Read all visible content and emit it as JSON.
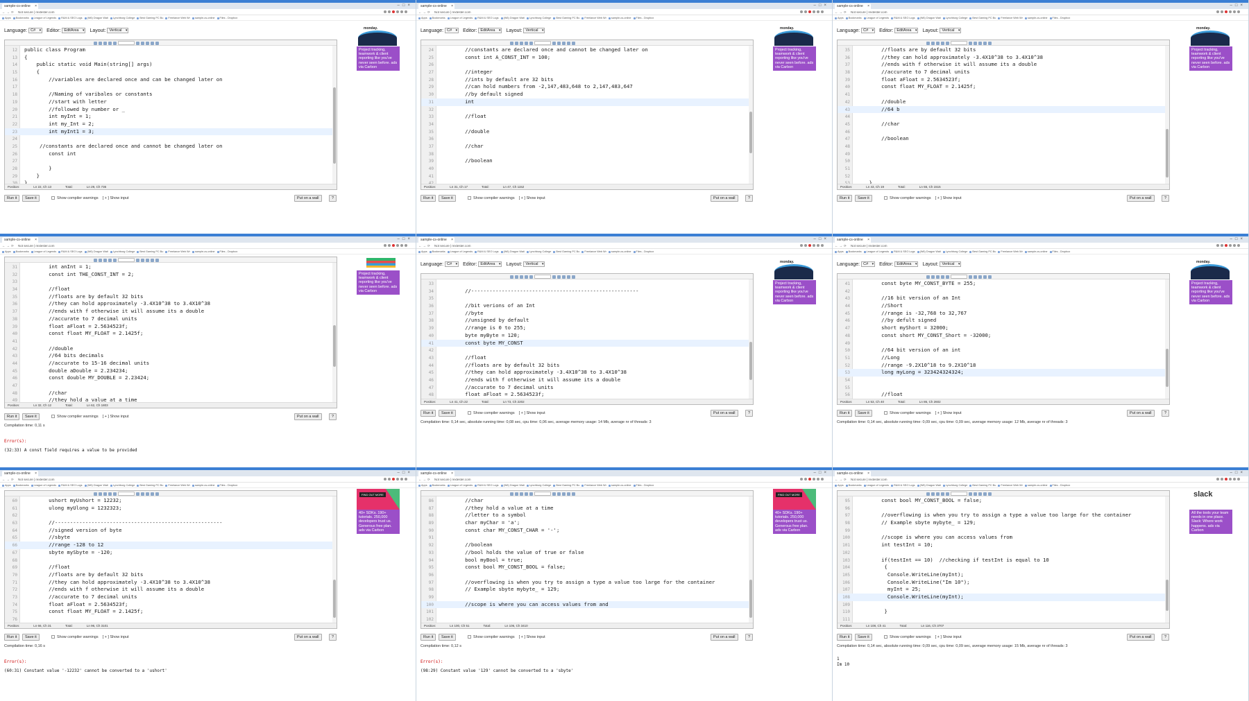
{
  "browser": {
    "tab_title": "sample-cs-online",
    "url": "Not secure | rextester.com",
    "bookmarks": [
      "Apps",
      "Bookmarks",
      "League of Legends",
      "R&M & SEO Logs",
      "(W6) Dragon Wati",
      "Lynchburg College",
      "Best Gaming PC Bu",
      "Freelance Web Wr",
      "sample-cs-online",
      "Files - Dropbox"
    ]
  },
  "options": {
    "language_label": "Language:",
    "language_value": "C#",
    "editor_label": "Editor:",
    "editor_value": "EditArea",
    "layout_label": "Layout:",
    "layout_value": "Vertical"
  },
  "buttons": {
    "run": "Run it",
    "save": "Save it",
    "warnings": "Show compiler warnings",
    "input": "[ + ] Show input",
    "wall": "Put on a wall",
    "help": "?"
  },
  "ads": {
    "monday_logo": "monday.",
    "monday_text": "Project tracking, teamwork & client reporting like you've never seen before. ads via Carbon",
    "pink_cta": "FIND OUT MORE",
    "pink_text": "40+ SDKs. 190+ tutorials. 250,000 developers trust us. Generous free plan. ads via Carbon",
    "slack_logo": "slack",
    "slack_text": "All the tools your team needs in one place. Slack: Where work happens. ads via Carbon"
  },
  "panels": [
    {
      "lines": [
        {
          "n": "12",
          "t": "public class Program"
        },
        {
          "n": "13",
          "t": "{"
        },
        {
          "n": "14",
          "t": "    public static void Main(string[] args)"
        },
        {
          "n": "15",
          "t": "    {"
        },
        {
          "n": "16",
          "t": "        //variables are declared once and can be changed later on"
        },
        {
          "n": "17",
          "t": ""
        },
        {
          "n": "18",
          "t": "        //Naming of varibales or constants"
        },
        {
          "n": "19",
          "t": "        //start with letter"
        },
        {
          "n": "20",
          "t": "        //followed by number or _"
        },
        {
          "n": "21",
          "t": "        int myInt = 1;"
        },
        {
          "n": "22",
          "t": "        int my_Int = 2;"
        },
        {
          "n": "23",
          "t": "        int myInt1 = 3;"
        },
        {
          "n": "24",
          "t": ""
        },
        {
          "n": "25",
          "t": "     //constants are declared once and cannot be changed later on"
        },
        {
          "n": "26",
          "t": "        const int"
        },
        {
          "n": "27",
          "t": ""
        },
        {
          "n": "28",
          "t": "        }"
        },
        {
          "n": "29",
          "t": "    }"
        },
        {
          "n": "30",
          "t": "}"
        }
      ],
      "position": "Ln 22, Ch 13",
      "total": "Ln 29, Ch 736",
      "compilation": "",
      "errors_label": "",
      "error_text": "",
      "output": ""
    },
    {
      "lines": [
        {
          "n": "24",
          "t": "        //constants are declared once and cannot be changed later on"
        },
        {
          "n": "25",
          "t": "        const int A_CONST_INT = 100;"
        },
        {
          "n": "26",
          "t": ""
        },
        {
          "n": "27",
          "t": "        //integer"
        },
        {
          "n": "28",
          "t": "        //ints by default are 32 bits"
        },
        {
          "n": "29",
          "t": "        //can hold numbers from -2,147,483,648 to 2,147,483,647"
        },
        {
          "n": "30",
          "t": "        //by default signed"
        },
        {
          "n": "31",
          "t": "        int"
        },
        {
          "n": "32",
          "t": ""
        },
        {
          "n": "33",
          "t": "        //float"
        },
        {
          "n": "34",
          "t": ""
        },
        {
          "n": "35",
          "t": "        //double"
        },
        {
          "n": "36",
          "t": ""
        },
        {
          "n": "37",
          "t": "        //char"
        },
        {
          "n": "38",
          "t": ""
        },
        {
          "n": "39",
          "t": "        //boolean"
        },
        {
          "n": "40",
          "t": ""
        },
        {
          "n": "41",
          "t": ""
        },
        {
          "n": "42",
          "t": ""
        }
      ],
      "position": "Ln 31, Ch 17",
      "total": "Ln 47, Ch 1152",
      "compilation": "",
      "errors_label": "",
      "error_text": "",
      "output": ""
    },
    {
      "lines": [
        {
          "n": "35",
          "t": "        //floats are by default 32 bits"
        },
        {
          "n": "36",
          "t": "        //they can hold approximately -3.4X10^38 to 3.4X10^38"
        },
        {
          "n": "37",
          "t": "        //ends with f otherwise it will assume its a double"
        },
        {
          "n": "38",
          "t": "        //accurate to 7 decimal units"
        },
        {
          "n": "39",
          "t": "        float aFloat = 2.5634523f;"
        },
        {
          "n": "40",
          "t": "        const float MY_FLOAT = 2.1425f;"
        },
        {
          "n": "41",
          "t": ""
        },
        {
          "n": "42",
          "t": "        //double"
        },
        {
          "n": "43",
          "t": "        //64 b"
        },
        {
          "n": "44",
          "t": ""
        },
        {
          "n": "45",
          "t": "        //char"
        },
        {
          "n": "46",
          "t": ""
        },
        {
          "n": "47",
          "t": "        //boolean"
        },
        {
          "n": "48",
          "t": ""
        },
        {
          "n": "49",
          "t": ""
        },
        {
          "n": "50",
          "t": ""
        },
        {
          "n": "51",
          "t": ""
        },
        {
          "n": "52",
          "t": ""
        },
        {
          "n": "53",
          "t": "    }"
        }
      ],
      "position": "Ln 43, Ch 19",
      "total": "Ln 55, Ch 1515",
      "compilation": "",
      "errors_label": "",
      "error_text": "",
      "output": ""
    },
    {
      "lines": [
        {
          "n": "31",
          "t": "        int anInt = 1;"
        },
        {
          "n": "32",
          "t": "        const int THE_CONST_INT = 2;"
        },
        {
          "n": "33",
          "t": ""
        },
        {
          "n": "34",
          "t": "        //float"
        },
        {
          "n": "35",
          "t": "        //floats are by default 32 bits"
        },
        {
          "n": "36",
          "t": "        //they can hold approximately -3.4X10^38 to 3.4X10^38"
        },
        {
          "n": "37",
          "t": "        //ends with f otherwise it will assume its a double"
        },
        {
          "n": "38",
          "t": "        //accurate to 7 decimal units"
        },
        {
          "n": "39",
          "t": "        float aFloat = 2.5634523f;"
        },
        {
          "n": "40",
          "t": "        const float MY_FLOAT = 2.1425f;"
        },
        {
          "n": "41",
          "t": ""
        },
        {
          "n": "42",
          "t": "        //double"
        },
        {
          "n": "43",
          "t": "        //64 bits decimals"
        },
        {
          "n": "44",
          "t": "        //accurate to 15-16 decimal units"
        },
        {
          "n": "45",
          "t": "        double aDouble = 2.234234;"
        },
        {
          "n": "46",
          "t": "        const double MY_DOUBLE = 2.23424;"
        },
        {
          "n": "47",
          "t": ""
        },
        {
          "n": "48",
          "t": "        //char"
        },
        {
          "n": "49",
          "t": "        //they hold a value at a time"
        }
      ],
      "position": "Ln 32, Ch 12",
      "total": "Ln 62, Ch 1803",
      "compilation": "Compilation time: 0,11 s",
      "errors_label": "Error(s):",
      "error_text": "(32:33) A const field requires a value to be provided",
      "output": ""
    },
    {
      "lines": [
        {
          "n": "33",
          "t": ""
        },
        {
          "n": "34",
          "t": "        //-------------------------------------------------------"
        },
        {
          "n": "35",
          "t": ""
        },
        {
          "n": "36",
          "t": "        //bit verions of an Int"
        },
        {
          "n": "37",
          "t": "        //byte"
        },
        {
          "n": "38",
          "t": "        //unsigned by default"
        },
        {
          "n": "39",
          "t": "        //range is 0 to 255;"
        },
        {
          "n": "40",
          "t": "        byte myByte = 120;"
        },
        {
          "n": "41",
          "t": "        const byte MY_CONST"
        },
        {
          "n": "42",
          "t": ""
        },
        {
          "n": "43",
          "t": "        //float"
        },
        {
          "n": "44",
          "t": "        //floats are by default 32 bits"
        },
        {
          "n": "45",
          "t": "        //they can hold approximately -3.4X10^38 to 3.4X10^38"
        },
        {
          "n": "46",
          "t": "        //ends with f otherwise it will assume its a double"
        },
        {
          "n": "47",
          "t": "        //accurate to 7 decimal units"
        },
        {
          "n": "48",
          "t": "        float aFloat = 2.5634523f;"
        },
        {
          "n": "49",
          "t": "        const float MY_FLOAT = 2.1425f;"
        },
        {
          "n": "50",
          "t": ""
        },
        {
          "n": "51",
          "t": "        //double"
        }
      ],
      "position": "Ln 41, Ch 22",
      "total": "Ln 73, Ch 2202",
      "compilation": "Compilation time: 0,14 sec, absolute running time: 0,08 sec, cpu time: 0,06 sec, average memory usage: 14 Mb, average nr of threads: 3",
      "errors_label": "",
      "error_text": "",
      "output": ""
    },
    {
      "lines": [
        {
          "n": "41",
          "t": "        const byte MY_CONST_BYTE = 255;"
        },
        {
          "n": "42",
          "t": ""
        },
        {
          "n": "43",
          "t": "        //16 bit version of an Int"
        },
        {
          "n": "44",
          "t": "        //Short"
        },
        {
          "n": "45",
          "t": "        //range is -32,768 to 32,767"
        },
        {
          "n": "46",
          "t": "        //by defult signed"
        },
        {
          "n": "47",
          "t": "        short myShort = 32000;"
        },
        {
          "n": "48",
          "t": "        const short MY_CONST_Short = -32000;"
        },
        {
          "n": "49",
          "t": ""
        },
        {
          "n": "50",
          "t": "        //64 bit version of an int"
        },
        {
          "n": "51",
          "t": "        //Long"
        },
        {
          "n": "52",
          "t": "        //range -9.2X10^18 to 9.2X10^18"
        },
        {
          "n": "53",
          "t": "        long myLong = 323424324324;"
        },
        {
          "n": "54",
          "t": ""
        },
        {
          "n": "55",
          "t": ""
        },
        {
          "n": "56",
          "t": "        //float"
        },
        {
          "n": "57",
          "t": "        //floats are by default 32 bits"
        },
        {
          "n": "58",
          "t": "        //they can hold approximately -3.4X10^38 to 3.4X10^38"
        },
        {
          "n": "59",
          "t": "        //ends with f otherwise it will assume its a double"
        }
      ],
      "position": "Ln 53, Ch 40",
      "total": "Ln 86, Ch 2602",
      "compilation": "Compilation time: 0,14 sec, absolute running time: 0,09 sec, cpu time: 0,09 sec, average memory usage: 12 Mb, average nr of threads: 3",
      "errors_label": "",
      "error_text": "",
      "output": ""
    },
    {
      "lines": [
        {
          "n": "60",
          "t": "        ushort myUshort = 12232;"
        },
        {
          "n": "61",
          "t": "        ulong myUlong = 1232323;"
        },
        {
          "n": "62",
          "t": ""
        },
        {
          "n": "63",
          "t": "        //-------------------------------------------------------"
        },
        {
          "n": "64",
          "t": "        //signed version of byte"
        },
        {
          "n": "65",
          "t": "        //sbyte"
        },
        {
          "n": "66",
          "t": "        //range -128 to 12"
        },
        {
          "n": "67",
          "t": "        sbyte mySbyte = -120;"
        },
        {
          "n": "68",
          "t": ""
        },
        {
          "n": "69",
          "t": "        //float"
        },
        {
          "n": "70",
          "t": "        //floats are by default 32 bits"
        },
        {
          "n": "71",
          "t": "        //they can hold approximately -3.4X10^38 to 3.4X10^38"
        },
        {
          "n": "72",
          "t": "        //ends with f otherwise it will assume its a double"
        },
        {
          "n": "73",
          "t": "        //accurate to 7 decimal units"
        },
        {
          "n": "74",
          "t": "        float aFloat = 2.5634523f;"
        },
        {
          "n": "75",
          "t": "        const float MY_FLOAT = 2.1425f;"
        },
        {
          "n": "76",
          "t": ""
        },
        {
          "n": "77",
          "t": "        //double"
        },
        {
          "n": "78",
          "t": "        //64 bits decimals"
        }
      ],
      "position": "Ln 66, Ch 31",
      "total": "Ln 96, Ch 3101",
      "compilation": "Compilation time: 0,16 s",
      "errors_label": "Error(s):",
      "error_text": "(60:31) Constant value '-12232' cannot be converted to a 'ushort'",
      "output": ""
    },
    {
      "lines": [
        {
          "n": "86",
          "t": "        //char"
        },
        {
          "n": "87",
          "t": "        //they hold a value at a time"
        },
        {
          "n": "88",
          "t": "        //letter to a symbol"
        },
        {
          "n": "89",
          "t": "        char myChar = 'a';"
        },
        {
          "n": "90",
          "t": "        const char MY_CONST_CHAR = '-';"
        },
        {
          "n": "91",
          "t": ""
        },
        {
          "n": "92",
          "t": "        //boolean"
        },
        {
          "n": "93",
          "t": "        //bool holds the value of true or false"
        },
        {
          "n": "94",
          "t": "        bool myBool = true;"
        },
        {
          "n": "95",
          "t": "        const bool MY_CONST_BOOL = false;"
        },
        {
          "n": "96",
          "t": ""
        },
        {
          "n": "97",
          "t": "        //overflowing is when you try to assign a type a value too large for the container"
        },
        {
          "n": "98",
          "t": "        // Example sbyte mybyte_ = 129;"
        },
        {
          "n": "99",
          "t": ""
        },
        {
          "n": "100",
          "t": "        //scope is where you can access values from and"
        },
        {
          "n": "101",
          "t": ""
        },
        {
          "n": "102",
          "t": ""
        },
        {
          "n": "103",
          "t": ""
        },
        {
          "n": "104",
          "t": "    }"
        }
      ],
      "position": "Ln 100, Ch 51",
      "total": "Ln 106, Ch 3410",
      "compilation": "Compilation time: 0,12 s",
      "errors_label": "Error(s):",
      "error_text": "(98:29) Constant value '129' cannot be converted to a 'sbyte'",
      "output": ""
    },
    {
      "lines": [
        {
          "n": "95",
          "t": "        const bool MY_CONST_BOOL = false;"
        },
        {
          "n": "96",
          "t": ""
        },
        {
          "n": "97",
          "t": "        //overflowing is when you try to assign a type a value too large for the container"
        },
        {
          "n": "98",
          "t": "        // Example sbyte mybyte_ = 129;"
        },
        {
          "n": "99",
          "t": ""
        },
        {
          "n": "100",
          "t": "        //scope is where you can access values from"
        },
        {
          "n": "101",
          "t": "        int testInt = 10;"
        },
        {
          "n": "102",
          "t": ""
        },
        {
          "n": "103",
          "t": "        if(testInt == 10)  //checking if testInt is equal to 10"
        },
        {
          "n": "104",
          "t": "         {"
        },
        {
          "n": "105",
          "t": "          Console.WriteLine(myInt);"
        },
        {
          "n": "106",
          "t": "          Console.WriteLine(\"Im 10\");"
        },
        {
          "n": "107",
          "t": "          myInt = 25;"
        },
        {
          "n": "108",
          "t": "          Console.WriteLine(myInt);"
        },
        {
          "n": "109",
          "t": ""
        },
        {
          "n": "110",
          "t": "         }"
        },
        {
          "n": "111",
          "t": ""
        },
        {
          "n": "112",
          "t": ""
        },
        {
          "n": "113",
          "t": ""
        }
      ],
      "position": "Ln 108, Ch 41",
      "total": "Ln 116, Ch 3707",
      "compilation": "Compilation time: 0,14 sec, absolute running time: 0,09 sec, cpu time: 0,09 sec, average memory usage: 15 Mb, average nr of threads: 3",
      "errors_label": "",
      "error_text": "",
      "output": "1\nIm 10"
    }
  ]
}
